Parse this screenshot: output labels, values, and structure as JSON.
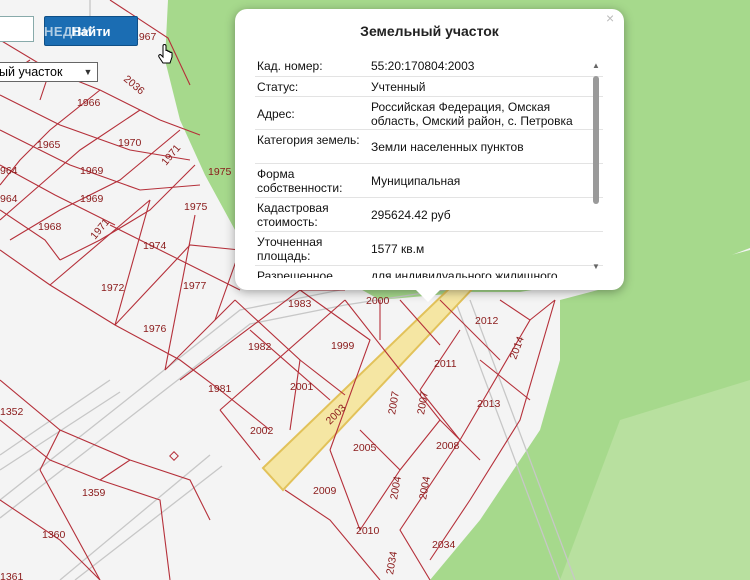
{
  "search": {
    "input_value": "",
    "button_label": "Найти"
  },
  "layer_select": {
    "selected": "ый участок"
  },
  "watermark": "НЕДВИ",
  "popup": {
    "title": "Земельный участок",
    "close_symbol": "×",
    "rows": [
      {
        "key": "Кад. номер:",
        "value": "55:20:170804:2003"
      },
      {
        "key": "Статус:",
        "value": "Учтенный"
      },
      {
        "key": "Адрес:",
        "value": "Российская Федерация, Омская область, Омский район, с. Петровка"
      },
      {
        "key": "Категория земель:",
        "value": "Земли населенных пунктов"
      },
      {
        "key": "Форма собственности:",
        "value": "Муниципальная"
      },
      {
        "key": "Кадастровая стоимость:",
        "value": "295624.42 руб"
      },
      {
        "key": "Уточненная площадь:",
        "value": "1577 кв.м"
      },
      {
        "key": "Разрешенное",
        "value": "для индивидуального жилищного"
      }
    ]
  },
  "map": {
    "colors": {
      "background": "#f4f4f4",
      "green": "#a6d98c",
      "boundary": "#b5303a",
      "highlight_fill": "#f5e6a3",
      "highlight_stroke": "#e2c25a",
      "road": "#c7c7c7"
    },
    "plot_labels": [
      {
        "text": "1967"
      },
      {
        "text": "2036"
      },
      {
        "text": "1966"
      },
      {
        "text": "1965"
      },
      {
        "text": "1970"
      },
      {
        "text": "964"
      },
      {
        "text": "1969"
      },
      {
        "text": "1971"
      },
      {
        "text": "1975"
      },
      {
        "text": "964"
      },
      {
        "text": "1969"
      },
      {
        "text": "1968"
      },
      {
        "text": "1971"
      },
      {
        "text": "1975"
      },
      {
        "text": "1974"
      },
      {
        "text": "1972"
      },
      {
        "text": "1977"
      },
      {
        "text": "1976"
      },
      {
        "text": "1983"
      },
      {
        "text": "2000"
      },
      {
        "text": "2012"
      },
      {
        "text": "2014"
      },
      {
        "text": "1982"
      },
      {
        "text": "1999"
      },
      {
        "text": "2011"
      },
      {
        "text": "1981"
      },
      {
        "text": "2001"
      },
      {
        "text": "2003"
      },
      {
        "text": "2007"
      },
      {
        "text": "2007"
      },
      {
        "text": "2013"
      },
      {
        "text": "1352"
      },
      {
        "text": "2002"
      },
      {
        "text": "2005"
      },
      {
        "text": "2008"
      },
      {
        "text": "1359"
      },
      {
        "text": "2009"
      },
      {
        "text": "2004"
      },
      {
        "text": "2004"
      },
      {
        "text": "1360"
      },
      {
        "text": "2010"
      },
      {
        "text": "2034"
      },
      {
        "text": "2034"
      },
      {
        "text": "1361"
      }
    ]
  }
}
